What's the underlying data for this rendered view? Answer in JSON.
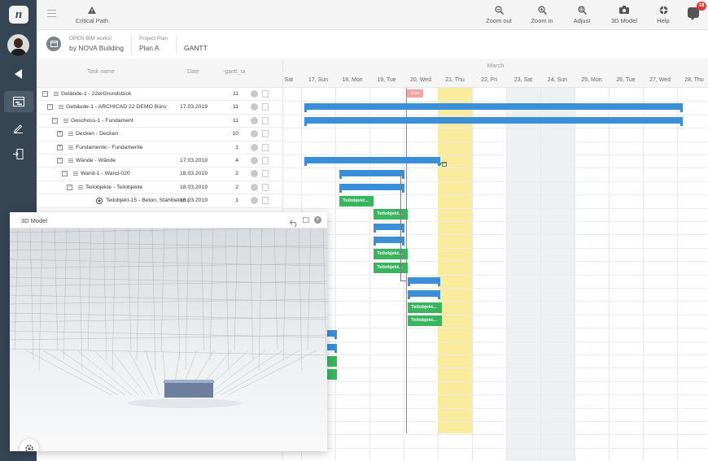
{
  "rail": {
    "logo": "n"
  },
  "toolbar": {
    "critical_path": "Critical Path",
    "zoom_out": "Zoom out",
    "zoom_in": "Zoom in",
    "adjust": "Adjust",
    "model_3d": "3D Model",
    "help": "Help",
    "notifications_count": "18"
  },
  "project": {
    "org_line1": "OPEN BIM works!",
    "org_line2": "by NOVA Building",
    "plan_caption": "Project Plan",
    "plan_name": "Plan A",
    "view": "GANTT"
  },
  "grid": {
    "col_task": "Task name",
    "col_date": "Date",
    "col_gantt": "-gantt_ta",
    "rows": [
      {
        "name": "Gelände-1 - 22erGrundstück",
        "date": "",
        "value": "11",
        "level": 0,
        "toggle": "minus"
      },
      {
        "name": "Gebäude-1 - ARCHICAD 22 DEMO Büro",
        "date": "17.03.2019",
        "value": "11",
        "level": 1,
        "toggle": "minus"
      },
      {
        "name": "Geschoss-1 - Fundament",
        "date": "",
        "value": "11",
        "level": 2,
        "toggle": "minus"
      },
      {
        "name": "Decken - Decken",
        "date": "",
        "value": "10",
        "level": 3,
        "toggle": "plus"
      },
      {
        "name": "Fundamente - Fundamente",
        "date": "",
        "value": "1",
        "level": 3,
        "toggle": "plus"
      },
      {
        "name": "Wände - Wände",
        "date": "17.03.2019",
        "value": "4",
        "level": 3,
        "toggle": "minus"
      },
      {
        "name": "Wand-1 - Wand-020",
        "date": "18.03.2019",
        "value": "2",
        "level": 4,
        "toggle": "minus"
      },
      {
        "name": "Teilobjekte - Teilobjekte",
        "date": "18.03.2019",
        "value": "2",
        "level": 5,
        "toggle": "minus"
      },
      {
        "name": "Teilobjekt-15 - Beton, Stahlbeton (",
        "date": "18.03.2019",
        "value": "1",
        "level": 6,
        "toggle": "leaf"
      }
    ]
  },
  "timeline": {
    "month": "March",
    "days": [
      "16, Sat",
      "17, Sun",
      "18, Mon",
      "19, Tue",
      "20, Wed",
      "21, Thu",
      "22, Fri",
      "23, Sat",
      "24, Sun",
      "25, Mon",
      "26, Tue",
      "27, Wed",
      "28, Thu"
    ],
    "start_label": "Start",
    "task_label": "Teilobjekt..."
  },
  "model_panel": {
    "title": "3D Model"
  },
  "colors": {
    "rail": "#354554",
    "summary_bar": "#3a8fd8",
    "task_bar": "#39b560",
    "today": "#fbeb9d",
    "marker": "#e06a6a"
  }
}
